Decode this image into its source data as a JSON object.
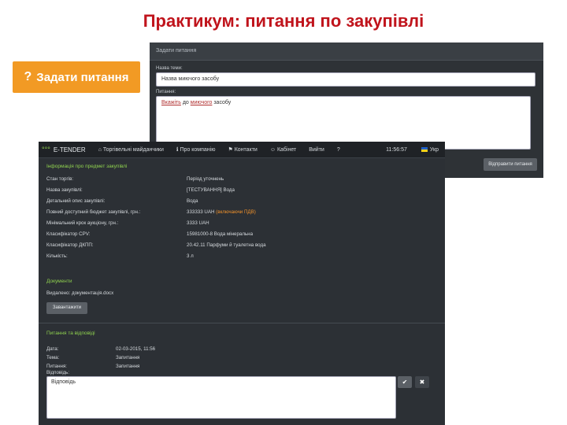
{
  "slide": {
    "title": "Практикум: питання по закупівлі"
  },
  "ask_button": {
    "label": "Задати питання",
    "icon": "question-icon",
    "color": "#f29a24"
  },
  "question_dialog": {
    "title": "Задати питання",
    "topic_label": "Назва теми:",
    "topic_value": "Назва миючого засобу",
    "question_label": "Питання:",
    "question_value_1": "Вкажіть",
    "question_value_2": " до ",
    "question_value_3": "миючого",
    "question_value_4": " засобу",
    "send_label": "Відправити питання"
  },
  "nav": {
    "logo": "E-TENDER",
    "items": [
      "Торгівельні майданчики",
      "Про компанію",
      "Контакти",
      "Кабінет",
      "Вийти",
      "?"
    ],
    "time": "11:56:57",
    "lang": "Укр"
  },
  "info": {
    "section_title": "Інформація про предмет закупівлі",
    "rows": [
      {
        "k": "Стан торгів:",
        "v": "Період уточнень"
      },
      {
        "k": "Назва закупівлі:",
        "v": "[ТЕСТУВАННЯ] Вода"
      },
      {
        "k": "Детальний опис закупівлі:",
        "v": "Вода"
      },
      {
        "k": "Повний доступний бюджет закупівлі, грн.:",
        "v": "333333 UAH",
        "note": "(включаючи ПДВ)"
      },
      {
        "k": "Мінімальний крок аукціону, грн.:",
        "v": "3333 UAH"
      },
      {
        "k": "Класифікатор CPV:",
        "v": "15981000-8 Вода мінеральна"
      },
      {
        "k": "Класифікатор ДКПП:",
        "v": "20.42.11 Парфуми й туалетна вода"
      },
      {
        "k": "Кількість:",
        "v": "3 л"
      }
    ]
  },
  "documents": {
    "section_title": "Документи",
    "uploaded": "Видалено: документація.docx",
    "download_label": "Завантажити"
  },
  "qa": {
    "section_title": "Питання та відповіді",
    "rows": [
      {
        "k": "Дата:",
        "v": "02-03-2015, 11:56"
      },
      {
        "k": "Тема:",
        "v": "Запитання"
      },
      {
        "k": "Питання:",
        "v": "Запитання"
      },
      {
        "k": "Відповідь:",
        "v": ""
      }
    ],
    "answer_value": "Відповідь",
    "ok_icon": "check-icon",
    "close_icon": "close-icon"
  }
}
